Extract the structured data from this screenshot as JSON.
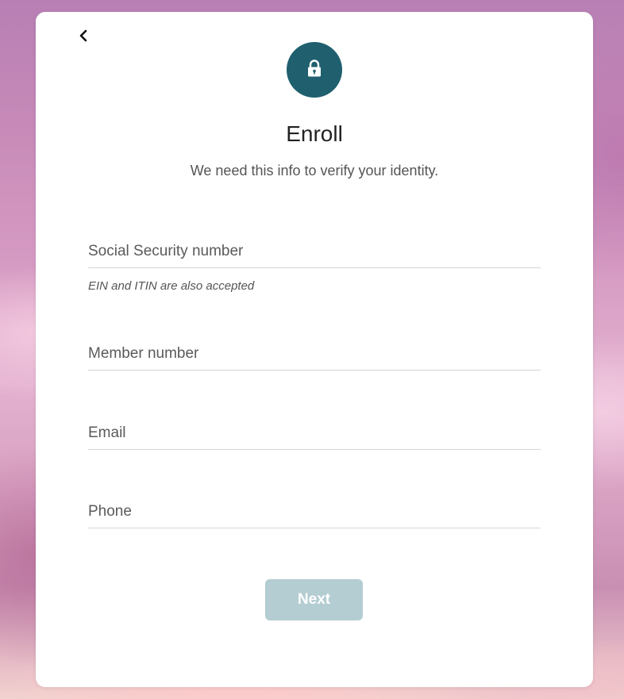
{
  "header": {
    "back_icon": "chevron-left-icon",
    "lock_icon": "lock-icon",
    "title": "Enroll",
    "subtitle": "We need this info to verify your identity."
  },
  "form": {
    "ssn": {
      "placeholder": "Social Security number",
      "value": "",
      "helper": "EIN and ITIN are also accepted"
    },
    "member": {
      "placeholder": "Member number",
      "value": ""
    },
    "email": {
      "placeholder": "Email",
      "value": ""
    },
    "phone": {
      "placeholder": "Phone",
      "value": ""
    },
    "next_label": "Next"
  },
  "colors": {
    "accent": "#1f5f6e",
    "button_disabled": "#b3cdd2"
  }
}
